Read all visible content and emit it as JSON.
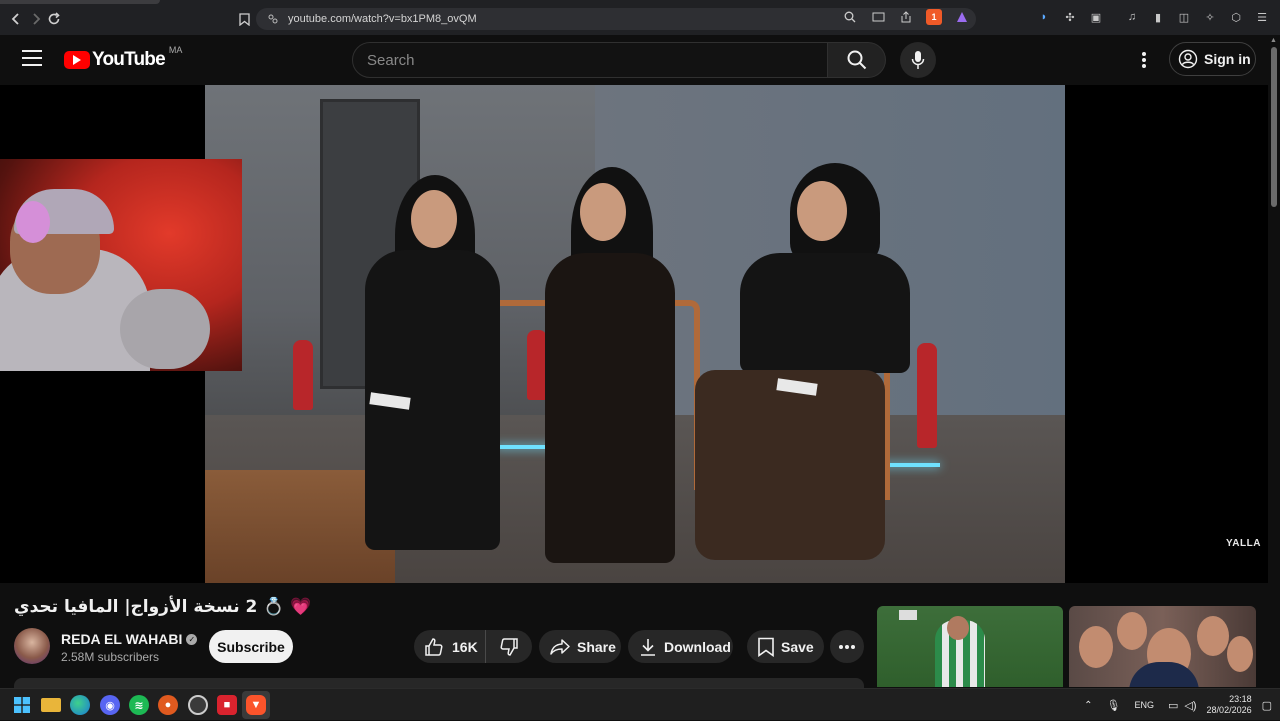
{
  "browser": {
    "url": "youtube.com/watch?v=bx1PM8_ovQM",
    "shield_count": "1"
  },
  "header": {
    "logo_text": "YouTube",
    "country_code": "MA",
    "search_placeholder": "Search",
    "signin_label": "Sign in"
  },
  "player": {
    "watermark": "YALLA"
  },
  "video": {
    "title": "💗 💍 2 نسخة الأزواج| المافيا تحدي",
    "channel_name": "REDA EL WAHABI",
    "subscribers": "2.58M subscribers",
    "subscribe_label": "Subscribe",
    "likes": "16K",
    "share_label": "Share",
    "download_label": "Download",
    "save_label": "Save"
  },
  "taskbar": {
    "language": "ENG",
    "time": "23:18",
    "date": "28/02/2026"
  },
  "colors": {
    "brand_red": "#ff0000",
    "background": "#0f0f0f",
    "pill": "#272727"
  }
}
